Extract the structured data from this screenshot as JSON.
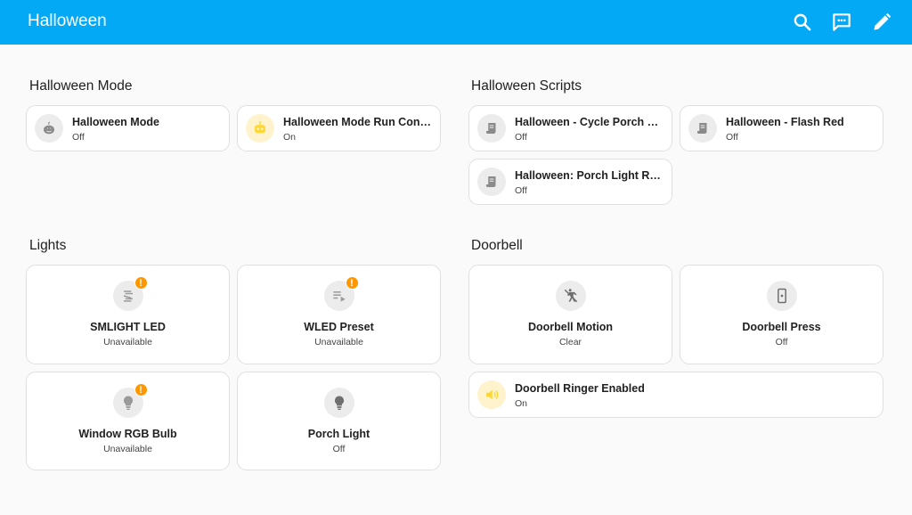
{
  "header": {
    "title": "Halloween",
    "icons": [
      "search-icon",
      "assist-chat-icon",
      "edit-pencil-icon"
    ]
  },
  "colors": {
    "header_bg": "#03a9f4",
    "active_yellow": "#fdd835",
    "warning_badge": "#ff9800"
  },
  "sections": {
    "halloween_mode": {
      "title": "Halloween Mode",
      "cards": [
        {
          "name": "Halloween Mode",
          "state": "Off",
          "icon": "pumpkin-icon"
        },
        {
          "name": "Halloween Mode Run Cont...",
          "state": "On",
          "icon": "robot-icon"
        }
      ]
    },
    "halloween_scripts": {
      "title": "Halloween Scripts",
      "cards": [
        {
          "name": "Halloween - Cycle Porch Li...",
          "state": "Off",
          "icon": "script-icon"
        },
        {
          "name": "Halloween - Flash Red",
          "state": "Off",
          "icon": "script-icon"
        },
        {
          "name": "Halloween: Porch Light Re...",
          "state": "Off",
          "icon": "script-icon"
        }
      ]
    },
    "lights": {
      "title": "Lights",
      "cards": [
        {
          "name": "SMLIGHT LED",
          "state": "Unavailable",
          "icon": "led-strip-icon",
          "badge": "!"
        },
        {
          "name": "WLED Preset",
          "state": "Unavailable",
          "icon": "playlist-play-icon",
          "badge": "!"
        },
        {
          "name": "Window RGB Bulb",
          "state": "Unavailable",
          "icon": "lightbulb-icon",
          "badge": "!"
        },
        {
          "name": "Porch Light",
          "state": "Off",
          "icon": "lightbulb-icon"
        }
      ]
    },
    "doorbell": {
      "title": "Doorbell",
      "cards": [
        {
          "name": "Doorbell Motion",
          "state": "Clear",
          "icon": "motion-sensor-off-icon"
        },
        {
          "name": "Doorbell Press",
          "state": "Off",
          "icon": "doorbell-icon"
        },
        {
          "name": "Doorbell Ringer Enabled",
          "state": "On",
          "icon": "volume-high-icon"
        }
      ]
    }
  }
}
